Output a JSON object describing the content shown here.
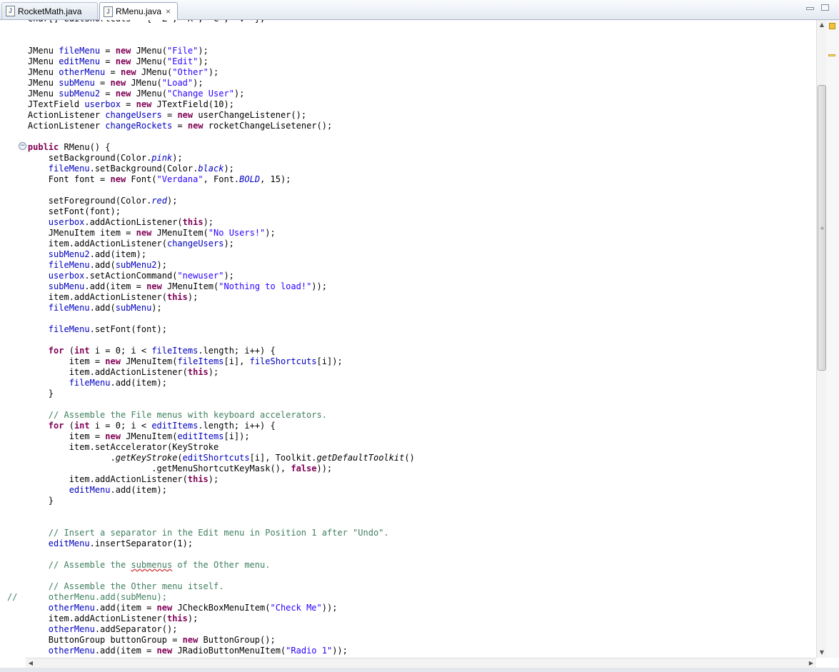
{
  "tabs": [
    {
      "label": "RocketMath.java",
      "icon": "java-file-icon",
      "active": false
    },
    {
      "label": "RMenu.java",
      "icon": "java-file-icon",
      "active": true
    }
  ],
  "tab_close": "×",
  "gutter": {
    "fold_marker": "−",
    "comment_marker": "//"
  },
  "code_lines": [
    [
      {
        "t": "    char[] editShortcuts = { 'Z', 'X', 'C', 'V' };"
      }
    ],
    [
      {
        "t": ""
      }
    ],
    [
      {
        "t": ""
      }
    ],
    [
      {
        "t": "    JMenu "
      },
      {
        "c": "fd",
        "t": "fileMenu"
      },
      {
        "t": " = "
      },
      {
        "c": "kw",
        "t": "new"
      },
      {
        "t": " JMenu("
      },
      {
        "c": "st",
        "t": "\"File\""
      },
      {
        "t": ");"
      }
    ],
    [
      {
        "t": "    JMenu "
      },
      {
        "c": "fd",
        "t": "editMenu"
      },
      {
        "t": " = "
      },
      {
        "c": "kw",
        "t": "new"
      },
      {
        "t": " JMenu("
      },
      {
        "c": "st",
        "t": "\"Edit\""
      },
      {
        "t": ");"
      }
    ],
    [
      {
        "t": "    JMenu "
      },
      {
        "c": "fd",
        "t": "otherMenu"
      },
      {
        "t": " = "
      },
      {
        "c": "kw",
        "t": "new"
      },
      {
        "t": " JMenu("
      },
      {
        "c": "st",
        "t": "\"Other\""
      },
      {
        "t": ");"
      }
    ],
    [
      {
        "t": "    JMenu "
      },
      {
        "c": "fd",
        "t": "subMenu"
      },
      {
        "t": " = "
      },
      {
        "c": "kw",
        "t": "new"
      },
      {
        "t": " JMenu("
      },
      {
        "c": "st",
        "t": "\"Load\""
      },
      {
        "t": ");"
      }
    ],
    [
      {
        "t": "    JMenu "
      },
      {
        "c": "fd",
        "t": "subMenu2"
      },
      {
        "t": " = "
      },
      {
        "c": "kw",
        "t": "new"
      },
      {
        "t": " JMenu("
      },
      {
        "c": "st",
        "t": "\"Change User\""
      },
      {
        "t": ");"
      }
    ],
    [
      {
        "t": "    JTextField "
      },
      {
        "c": "fd",
        "t": "userbox"
      },
      {
        "t": " = "
      },
      {
        "c": "kw",
        "t": "new"
      },
      {
        "t": " JTextField(10);"
      }
    ],
    [
      {
        "t": "    ActionListener "
      },
      {
        "c": "fd",
        "t": "changeUsers"
      },
      {
        "t": " = "
      },
      {
        "c": "kw",
        "t": "new"
      },
      {
        "t": " userChangeListener();"
      }
    ],
    [
      {
        "t": "    ActionListener "
      },
      {
        "c": "fd",
        "t": "changeRockets"
      },
      {
        "t": " = "
      },
      {
        "c": "kw",
        "t": "new"
      },
      {
        "t": " rocketChangeLisetener();"
      }
    ],
    [
      {
        "t": ""
      }
    ],
    [
      {
        "t": "    "
      },
      {
        "c": "kw",
        "t": "public"
      },
      {
        "t": " RMenu() {"
      }
    ],
    [
      {
        "t": "        setBackground(Color."
      },
      {
        "c": "fdi",
        "t": "pink"
      },
      {
        "t": ");"
      }
    ],
    [
      {
        "t": "        "
      },
      {
        "c": "fd",
        "t": "fileMenu"
      },
      {
        "t": ".setBackground(Color."
      },
      {
        "c": "fdi",
        "t": "black"
      },
      {
        "t": ");"
      }
    ],
    [
      {
        "t": "        Font font = "
      },
      {
        "c": "kw",
        "t": "new"
      },
      {
        "t": " Font("
      },
      {
        "c": "st",
        "t": "\"Verdana\""
      },
      {
        "t": ", Font."
      },
      {
        "c": "fdi",
        "t": "BOLD"
      },
      {
        "t": ", 15);"
      }
    ],
    [
      {
        "t": ""
      }
    ],
    [
      {
        "t": "        setForeground(Color."
      },
      {
        "c": "fdi",
        "t": "red"
      },
      {
        "t": ");"
      }
    ],
    [
      {
        "t": "        setFont(font);"
      }
    ],
    [
      {
        "t": "        "
      },
      {
        "c": "fd",
        "t": "userbox"
      },
      {
        "t": ".addActionListener("
      },
      {
        "c": "kw",
        "t": "this"
      },
      {
        "t": ");"
      }
    ],
    [
      {
        "t": "        JMenuItem item = "
      },
      {
        "c": "kw",
        "t": "new"
      },
      {
        "t": " JMenuItem("
      },
      {
        "c": "st",
        "t": "\"No Users!\""
      },
      {
        "t": ");"
      }
    ],
    [
      {
        "t": "        item.addActionListener("
      },
      {
        "c": "fd",
        "t": "changeUsers"
      },
      {
        "t": ");"
      }
    ],
    [
      {
        "t": "        "
      },
      {
        "c": "fd",
        "t": "subMenu2"
      },
      {
        "t": ".add(item);"
      }
    ],
    [
      {
        "t": "        "
      },
      {
        "c": "fd",
        "t": "fileMenu"
      },
      {
        "t": ".add("
      },
      {
        "c": "fd",
        "t": "subMenu2"
      },
      {
        "t": ");"
      }
    ],
    [
      {
        "t": "        "
      },
      {
        "c": "fd",
        "t": "userbox"
      },
      {
        "t": ".setActionCommand("
      },
      {
        "c": "st",
        "t": "\"newuser\""
      },
      {
        "t": ");"
      }
    ],
    [
      {
        "t": "        "
      },
      {
        "c": "fd",
        "t": "subMenu"
      },
      {
        "t": ".add(item = "
      },
      {
        "c": "kw",
        "t": "new"
      },
      {
        "t": " JMenuItem("
      },
      {
        "c": "st",
        "t": "\"Nothing to load!\""
      },
      {
        "t": "));"
      }
    ],
    [
      {
        "t": "        item.addActionListener("
      },
      {
        "c": "kw",
        "t": "this"
      },
      {
        "t": ");"
      }
    ],
    [
      {
        "t": "        "
      },
      {
        "c": "fd",
        "t": "fileMenu"
      },
      {
        "t": ".add("
      },
      {
        "c": "fd",
        "t": "subMenu"
      },
      {
        "t": ");"
      }
    ],
    [
      {
        "t": ""
      }
    ],
    [
      {
        "t": "        "
      },
      {
        "c": "fd",
        "t": "fileMenu"
      },
      {
        "t": ".setFont(font);"
      }
    ],
    [
      {
        "t": ""
      }
    ],
    [
      {
        "t": "        "
      },
      {
        "c": "kw",
        "t": "for"
      },
      {
        "t": " ("
      },
      {
        "c": "kw",
        "t": "int"
      },
      {
        "t": " i = 0; i < "
      },
      {
        "c": "fd",
        "t": "fileItems"
      },
      {
        "t": ".length; i++) {"
      }
    ],
    [
      {
        "t": "            item = "
      },
      {
        "c": "kw",
        "t": "new"
      },
      {
        "t": " JMenuItem("
      },
      {
        "c": "fd",
        "t": "fileItems"
      },
      {
        "t": "[i], "
      },
      {
        "c": "fd",
        "t": "fileShortcuts"
      },
      {
        "t": "[i]);"
      }
    ],
    [
      {
        "t": "            item.addActionListener("
      },
      {
        "c": "kw",
        "t": "this"
      },
      {
        "t": ");"
      }
    ],
    [
      {
        "t": "            "
      },
      {
        "c": "fd",
        "t": "fileMenu"
      },
      {
        "t": ".add(item);"
      }
    ],
    [
      {
        "t": "        }"
      }
    ],
    [
      {
        "t": ""
      }
    ],
    [
      {
        "t": "        "
      },
      {
        "c": "cm",
        "t": "// Assemble the File menus with keyboard accelerators."
      }
    ],
    [
      {
        "t": "        "
      },
      {
        "c": "kw",
        "t": "for"
      },
      {
        "t": " ("
      },
      {
        "c": "kw",
        "t": "int"
      },
      {
        "t": " i = 0; i < "
      },
      {
        "c": "fd",
        "t": "editItems"
      },
      {
        "t": ".length; i++) {"
      }
    ],
    [
      {
        "t": "            item = "
      },
      {
        "c": "kw",
        "t": "new"
      },
      {
        "t": " JMenuItem("
      },
      {
        "c": "fd",
        "t": "editItems"
      },
      {
        "t": "[i]);"
      }
    ],
    [
      {
        "t": "            item.setAccelerator(KeyStroke"
      }
    ],
    [
      {
        "t": "                    ."
      },
      {
        "c": "it",
        "t": "getKeyStroke"
      },
      {
        "t": "("
      },
      {
        "c": "fd",
        "t": "editShortcuts"
      },
      {
        "t": "[i], Toolkit."
      },
      {
        "c": "it",
        "t": "getDefaultToolkit"
      },
      {
        "t": "()"
      }
    ],
    [
      {
        "t": "                            .getMenuShortcutKeyMask(), "
      },
      {
        "c": "kw",
        "t": "false"
      },
      {
        "t": "));"
      }
    ],
    [
      {
        "t": "            item.addActionListener("
      },
      {
        "c": "kw",
        "t": "this"
      },
      {
        "t": ");"
      }
    ],
    [
      {
        "t": "            "
      },
      {
        "c": "fd",
        "t": "editMenu"
      },
      {
        "t": ".add(item);"
      }
    ],
    [
      {
        "t": "        }"
      }
    ],
    [
      {
        "t": ""
      }
    ],
    [
      {
        "t": ""
      }
    ],
    [
      {
        "t": "        "
      },
      {
        "c": "cm",
        "t": "// Insert a separator in the Edit menu in Position 1 after \"Undo\"."
      }
    ],
    [
      {
        "t": "        "
      },
      {
        "c": "fd",
        "t": "editMenu"
      },
      {
        "t": ".insertSeparator(1);"
      }
    ],
    [
      {
        "t": ""
      }
    ],
    [
      {
        "t": "        "
      },
      {
        "c": "cm",
        "t": "// Assemble the "
      },
      {
        "c": "cm sq",
        "t": "submenus"
      },
      {
        "c": "cm",
        "t": " of the Other menu."
      }
    ],
    [
      {
        "t": ""
      }
    ],
    [
      {
        "t": "        "
      },
      {
        "c": "cm",
        "t": "// Assemble the Other menu itself."
      }
    ],
    [
      {
        "c": "cm",
        "t": "//      otherMenu.add(subMenu);"
      }
    ],
    [
      {
        "t": "        "
      },
      {
        "c": "fd",
        "t": "otherMenu"
      },
      {
        "t": ".add(item = "
      },
      {
        "c": "kw",
        "t": "new"
      },
      {
        "t": " JCheckBoxMenuItem("
      },
      {
        "c": "st",
        "t": "\"Check Me\""
      },
      {
        "t": "));"
      }
    ],
    [
      {
        "t": "        item.addActionListener("
      },
      {
        "c": "kw",
        "t": "this"
      },
      {
        "t": ");"
      }
    ],
    [
      {
        "t": "        "
      },
      {
        "c": "fd",
        "t": "otherMenu"
      },
      {
        "t": ".addSeparator();"
      }
    ],
    [
      {
        "t": "        ButtonGroup buttonGroup = "
      },
      {
        "c": "kw",
        "t": "new"
      },
      {
        "t": " ButtonGroup();"
      }
    ],
    [
      {
        "t": "        "
      },
      {
        "c": "fd",
        "t": "otherMenu"
      },
      {
        "t": ".add(item = "
      },
      {
        "c": "kw",
        "t": "new"
      },
      {
        "t": " JRadioButtonMenuItem("
      },
      {
        "c": "st",
        "t": "\"Radio 1\""
      },
      {
        "t": "));"
      }
    ]
  ],
  "scroll": {
    "up_arrow": "▲",
    "down_arrow": "▼",
    "left_arrow": "◀",
    "right_arrow": "▶",
    "grip": "≡"
  }
}
